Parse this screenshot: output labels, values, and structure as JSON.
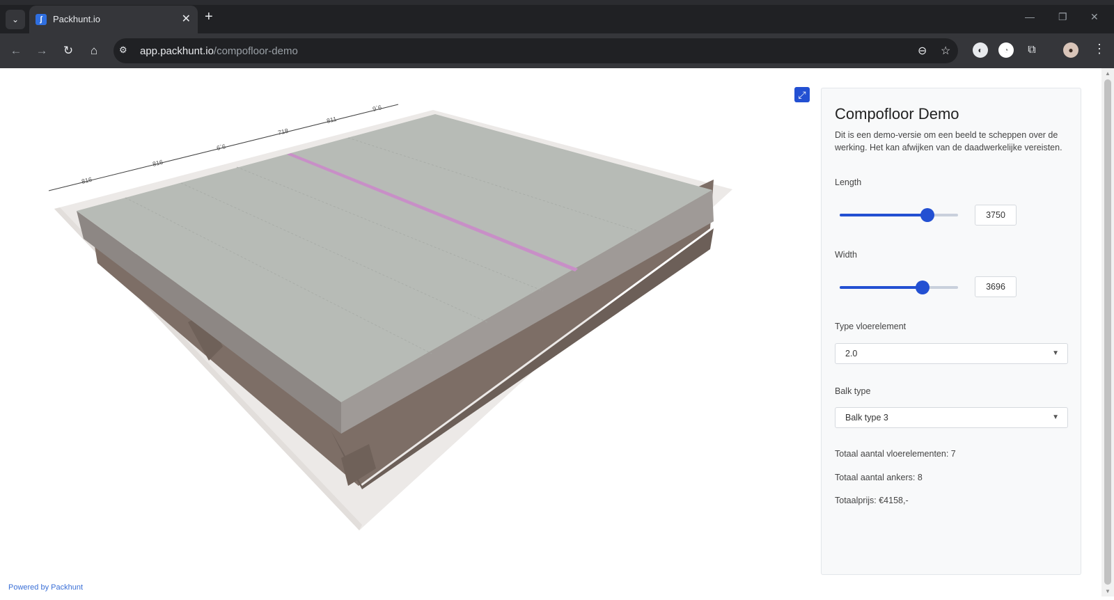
{
  "browser": {
    "tab_title": "Packhunt.io",
    "url_host": "app.packhunt.io",
    "url_path": "/compofloor-demo"
  },
  "viewer": {
    "powered_by": "Powered by Packhunt",
    "dimension_labels": [
      "816",
      "816",
      "6`6",
      "718",
      "811",
      "9`6"
    ]
  },
  "panel": {
    "title": "Compofloor Demo",
    "description": "Dit is een demo-versie om een beeld te scheppen over de werking. Het kan afwijken van de daadwerkelijke vereisten.",
    "length": {
      "label": "Length",
      "value": "3750",
      "fraction": 0.74
    },
    "width": {
      "label": "Width",
      "value": "3696",
      "fraction": 0.7
    },
    "type_vloerelement": {
      "label": "Type vloerelement",
      "selected": "2.0"
    },
    "balk_type": {
      "label": "Balk type",
      "selected": "Balk type 3"
    },
    "summary": {
      "vloerelementen": "Totaal aantal vloerelementen: 7",
      "ankers": "Totaal aantal ankers: 8",
      "prijs": "Totaalprijs: €4158,-"
    }
  },
  "colors": {
    "accent": "#2350d2",
    "slab_top": "#b7bbb6",
    "beam": "#7d6e66",
    "seam": "#c88fc7"
  }
}
